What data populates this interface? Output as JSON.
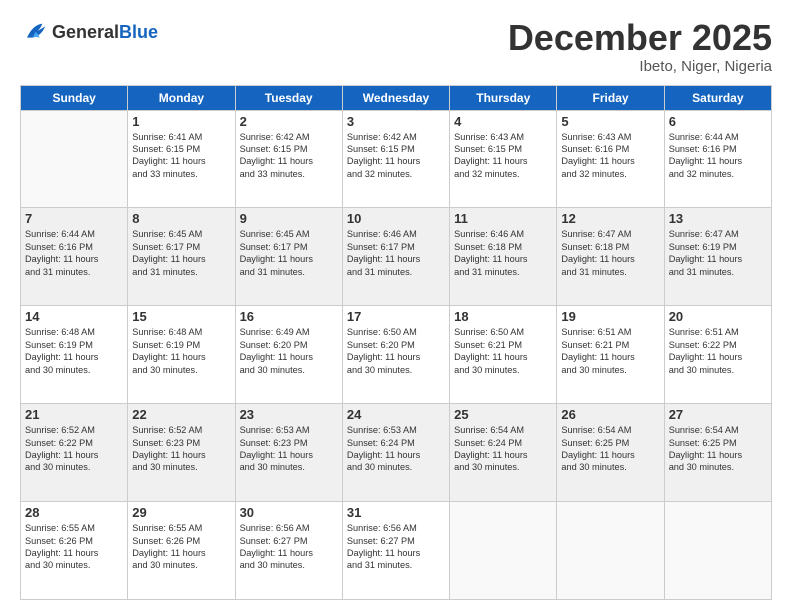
{
  "header": {
    "logo_general": "General",
    "logo_blue": "Blue",
    "month": "December 2025",
    "location": "Ibeto, Niger, Nigeria"
  },
  "days_of_week": [
    "Sunday",
    "Monday",
    "Tuesday",
    "Wednesday",
    "Thursday",
    "Friday",
    "Saturday"
  ],
  "weeks": [
    [
      {
        "num": "",
        "info": ""
      },
      {
        "num": "1",
        "info": "Sunrise: 6:41 AM\nSunset: 6:15 PM\nDaylight: 11 hours\nand 33 minutes."
      },
      {
        "num": "2",
        "info": "Sunrise: 6:42 AM\nSunset: 6:15 PM\nDaylight: 11 hours\nand 33 minutes."
      },
      {
        "num": "3",
        "info": "Sunrise: 6:42 AM\nSunset: 6:15 PM\nDaylight: 11 hours\nand 32 minutes."
      },
      {
        "num": "4",
        "info": "Sunrise: 6:43 AM\nSunset: 6:15 PM\nDaylight: 11 hours\nand 32 minutes."
      },
      {
        "num": "5",
        "info": "Sunrise: 6:43 AM\nSunset: 6:16 PM\nDaylight: 11 hours\nand 32 minutes."
      },
      {
        "num": "6",
        "info": "Sunrise: 6:44 AM\nSunset: 6:16 PM\nDaylight: 11 hours\nand 32 minutes."
      }
    ],
    [
      {
        "num": "7",
        "info": "Sunrise: 6:44 AM\nSunset: 6:16 PM\nDaylight: 11 hours\nand 31 minutes."
      },
      {
        "num": "8",
        "info": "Sunrise: 6:45 AM\nSunset: 6:17 PM\nDaylight: 11 hours\nand 31 minutes."
      },
      {
        "num": "9",
        "info": "Sunrise: 6:45 AM\nSunset: 6:17 PM\nDaylight: 11 hours\nand 31 minutes."
      },
      {
        "num": "10",
        "info": "Sunrise: 6:46 AM\nSunset: 6:17 PM\nDaylight: 11 hours\nand 31 minutes."
      },
      {
        "num": "11",
        "info": "Sunrise: 6:46 AM\nSunset: 6:18 PM\nDaylight: 11 hours\nand 31 minutes."
      },
      {
        "num": "12",
        "info": "Sunrise: 6:47 AM\nSunset: 6:18 PM\nDaylight: 11 hours\nand 31 minutes."
      },
      {
        "num": "13",
        "info": "Sunrise: 6:47 AM\nSunset: 6:19 PM\nDaylight: 11 hours\nand 31 minutes."
      }
    ],
    [
      {
        "num": "14",
        "info": "Sunrise: 6:48 AM\nSunset: 6:19 PM\nDaylight: 11 hours\nand 30 minutes."
      },
      {
        "num": "15",
        "info": "Sunrise: 6:48 AM\nSunset: 6:19 PM\nDaylight: 11 hours\nand 30 minutes."
      },
      {
        "num": "16",
        "info": "Sunrise: 6:49 AM\nSunset: 6:20 PM\nDaylight: 11 hours\nand 30 minutes."
      },
      {
        "num": "17",
        "info": "Sunrise: 6:50 AM\nSunset: 6:20 PM\nDaylight: 11 hours\nand 30 minutes."
      },
      {
        "num": "18",
        "info": "Sunrise: 6:50 AM\nSunset: 6:21 PM\nDaylight: 11 hours\nand 30 minutes."
      },
      {
        "num": "19",
        "info": "Sunrise: 6:51 AM\nSunset: 6:21 PM\nDaylight: 11 hours\nand 30 minutes."
      },
      {
        "num": "20",
        "info": "Sunrise: 6:51 AM\nSunset: 6:22 PM\nDaylight: 11 hours\nand 30 minutes."
      }
    ],
    [
      {
        "num": "21",
        "info": "Sunrise: 6:52 AM\nSunset: 6:22 PM\nDaylight: 11 hours\nand 30 minutes."
      },
      {
        "num": "22",
        "info": "Sunrise: 6:52 AM\nSunset: 6:23 PM\nDaylight: 11 hours\nand 30 minutes."
      },
      {
        "num": "23",
        "info": "Sunrise: 6:53 AM\nSunset: 6:23 PM\nDaylight: 11 hours\nand 30 minutes."
      },
      {
        "num": "24",
        "info": "Sunrise: 6:53 AM\nSunset: 6:24 PM\nDaylight: 11 hours\nand 30 minutes."
      },
      {
        "num": "25",
        "info": "Sunrise: 6:54 AM\nSunset: 6:24 PM\nDaylight: 11 hours\nand 30 minutes."
      },
      {
        "num": "26",
        "info": "Sunrise: 6:54 AM\nSunset: 6:25 PM\nDaylight: 11 hours\nand 30 minutes."
      },
      {
        "num": "27",
        "info": "Sunrise: 6:54 AM\nSunset: 6:25 PM\nDaylight: 11 hours\nand 30 minutes."
      }
    ],
    [
      {
        "num": "28",
        "info": "Sunrise: 6:55 AM\nSunset: 6:26 PM\nDaylight: 11 hours\nand 30 minutes."
      },
      {
        "num": "29",
        "info": "Sunrise: 6:55 AM\nSunset: 6:26 PM\nDaylight: 11 hours\nand 30 minutes."
      },
      {
        "num": "30",
        "info": "Sunrise: 6:56 AM\nSunset: 6:27 PM\nDaylight: 11 hours\nand 30 minutes."
      },
      {
        "num": "31",
        "info": "Sunrise: 6:56 AM\nSunset: 6:27 PM\nDaylight: 11 hours\nand 31 minutes."
      },
      {
        "num": "",
        "info": ""
      },
      {
        "num": "",
        "info": ""
      },
      {
        "num": "",
        "info": ""
      }
    ]
  ]
}
